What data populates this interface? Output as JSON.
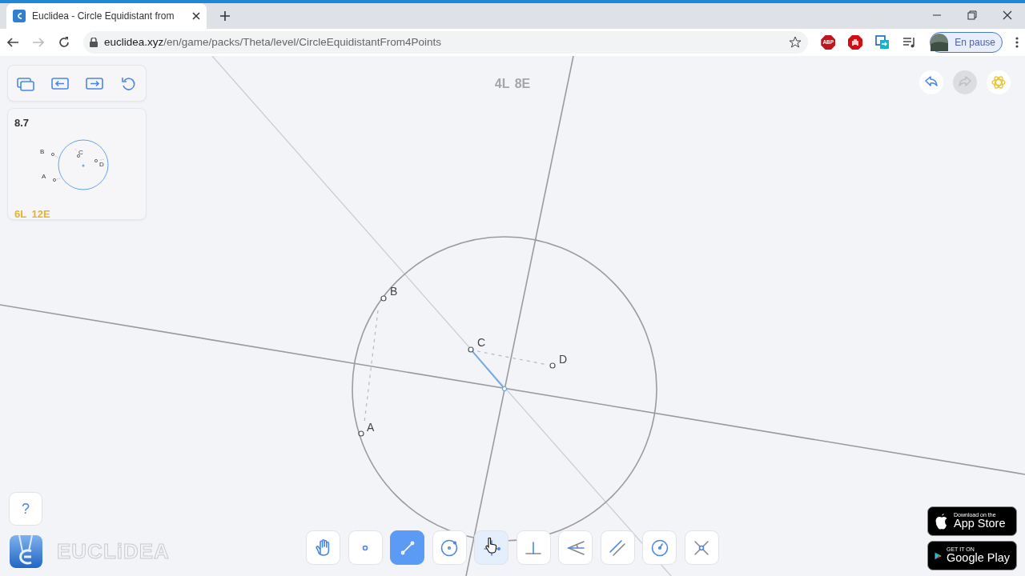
{
  "browser": {
    "tab_title": "Euclidea - Circle Equidistant from",
    "url_host": "euclidea.xyz",
    "url_path": "/en/game/packs/Theta/level/CircleEquidistantFrom4Points",
    "extension_label": "ABP",
    "profile": "En pause"
  },
  "level_card": {
    "number": "8.7",
    "goal": "6L 12E",
    "preview_labels": [
      "B",
      "C",
      "D",
      "A"
    ]
  },
  "score": "4L 8E",
  "top_buttons": [
    {
      "kind": "undo",
      "disabled": false
    },
    {
      "kind": "redo",
      "disabled": true
    },
    {
      "kind": "hint",
      "disabled": false
    }
  ],
  "points": [
    {
      "label": "B"
    },
    {
      "label": "C"
    },
    {
      "label": "D"
    },
    {
      "label": "A"
    }
  ],
  "tools": [
    {
      "kind": "hand",
      "selected": false,
      "hovered": false
    },
    {
      "kind": "point",
      "selected": false,
      "hovered": false
    },
    {
      "kind": "line",
      "selected": true,
      "hovered": false
    },
    {
      "kind": "circle",
      "selected": false,
      "hovered": false
    },
    {
      "kind": "bisector",
      "selected": false,
      "hovered": true
    },
    {
      "kind": "perpendicular",
      "selected": false,
      "hovered": false
    },
    {
      "kind": "angle",
      "selected": false,
      "hovered": false
    },
    {
      "kind": "parallel",
      "selected": false,
      "hovered": false
    },
    {
      "kind": "compass",
      "selected": false,
      "hovered": false
    },
    {
      "kind": "intersect",
      "selected": false,
      "hovered": false
    }
  ],
  "help": "?",
  "logo_text": "EUCLiDEA",
  "store_badges": [
    {
      "kind": "apple",
      "small": "Download on the",
      "big": "App Store"
    },
    {
      "kind": "google",
      "small": "GET IT ON",
      "big": "Google Play"
    }
  ]
}
